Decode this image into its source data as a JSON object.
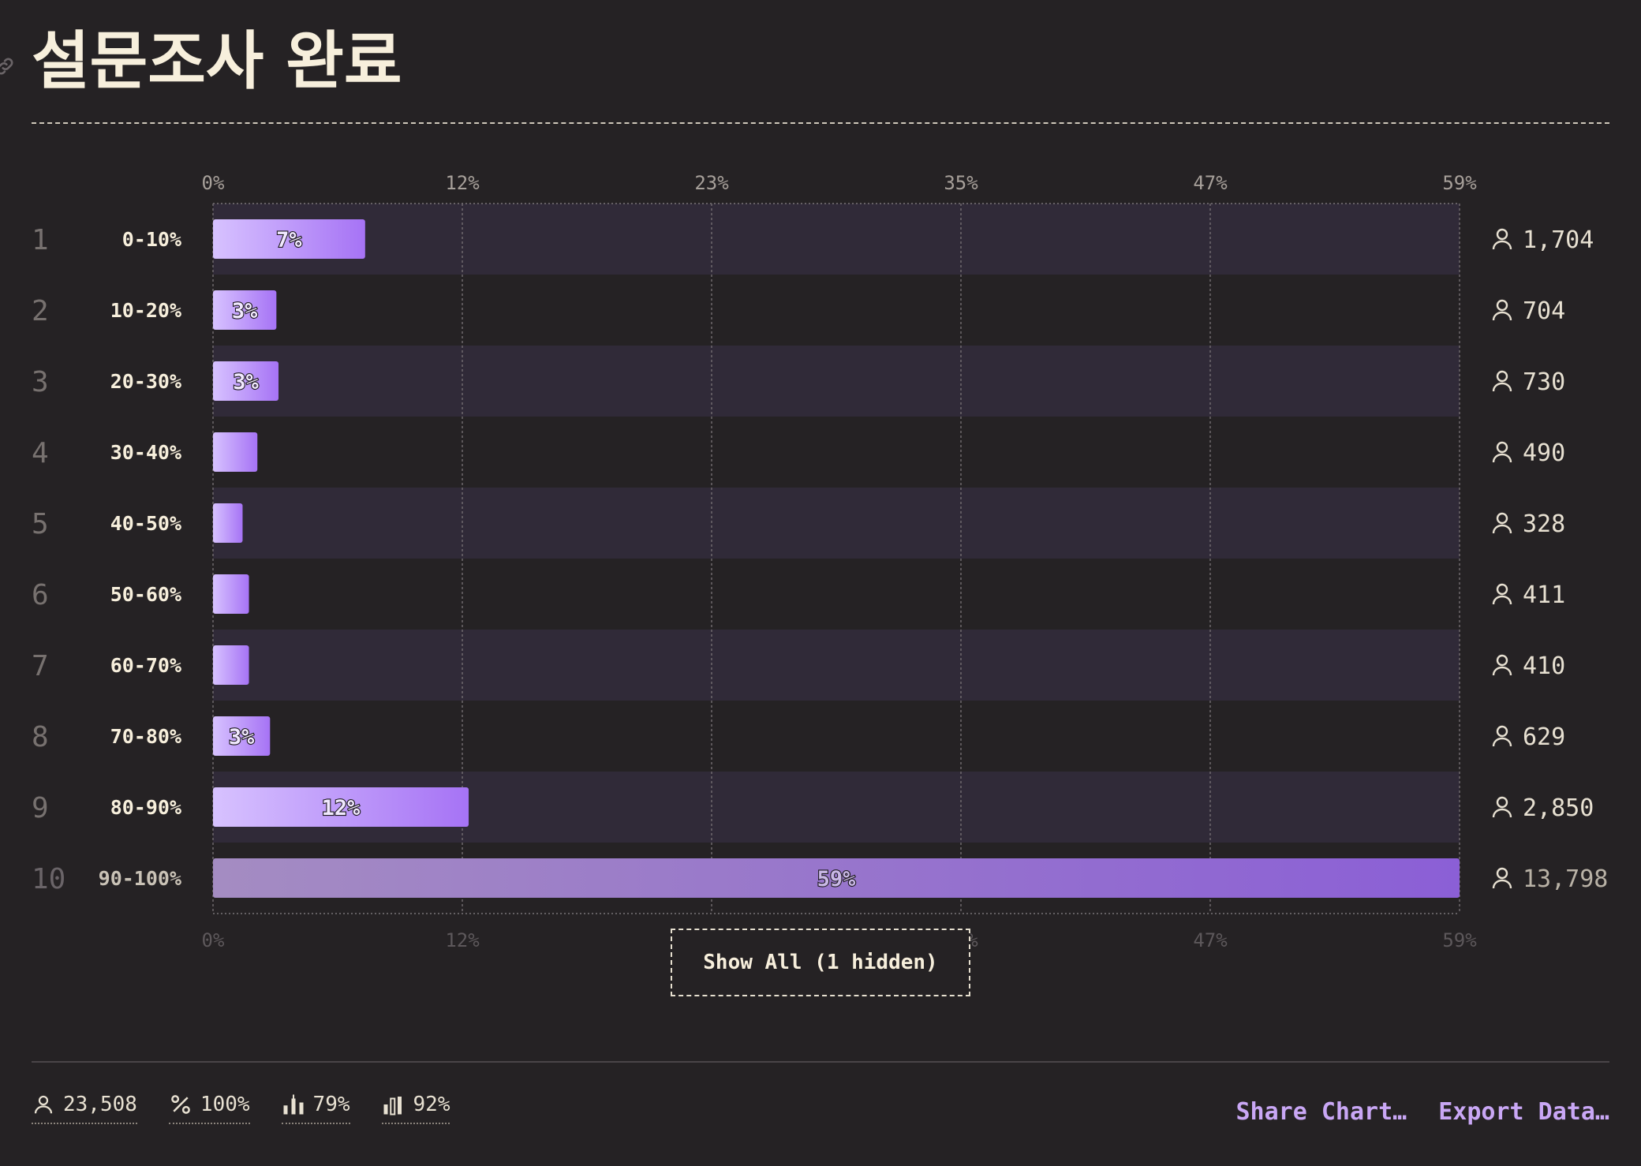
{
  "page": {
    "title": "설문조사 완료"
  },
  "chart_data": {
    "type": "bar",
    "orientation": "horizontal",
    "title": "설문조사 완료",
    "xlim": [
      0,
      59
    ],
    "ticks": [
      "0%",
      "12%",
      "23%",
      "35%",
      "47%",
      "59%"
    ],
    "tick_values": [
      0,
      11.8,
      23.6,
      35.4,
      47.2,
      59
    ],
    "grid": true,
    "categories": [
      "0-10%",
      "10-20%",
      "20-30%",
      "30-40%",
      "40-50%",
      "50-60%",
      "60-70%",
      "70-80%",
      "80-90%",
      "90-100%"
    ],
    "ranks": [
      "1",
      "2",
      "3",
      "4",
      "5",
      "6",
      "7",
      "8",
      "9",
      "10"
    ],
    "values": [
      7.2,
      3.0,
      3.1,
      2.1,
      1.4,
      1.7,
      1.7,
      2.7,
      12.1,
      59
    ],
    "value_labels": [
      "7%",
      "3%",
      "3%",
      "",
      "",
      "",
      "",
      "3%",
      "12%",
      "59%"
    ],
    "counts": [
      "1,704",
      "704",
      "730",
      "490",
      "328",
      "411",
      "410",
      "629",
      "2,850",
      "13,798"
    ],
    "highlighted_index": 9,
    "colors": {
      "bar_start": "#d7c2ff",
      "bar_end": "#a673f5",
      "highlight_start": "#a48cc2",
      "highlight_end": "#8b5fd6"
    }
  },
  "controls": {
    "show_all_label": "Show All (1 hidden)"
  },
  "footer": {
    "stats": [
      {
        "icon": "user-icon",
        "value": "23,508"
      },
      {
        "icon": "percent-icon",
        "value": "100%"
      },
      {
        "icon": "candlestick-icon",
        "value": "79%"
      },
      {
        "icon": "bar-chart-icon",
        "value": "92%"
      }
    ],
    "share_label": "Share Chart…",
    "export_label": "Export Data…"
  }
}
